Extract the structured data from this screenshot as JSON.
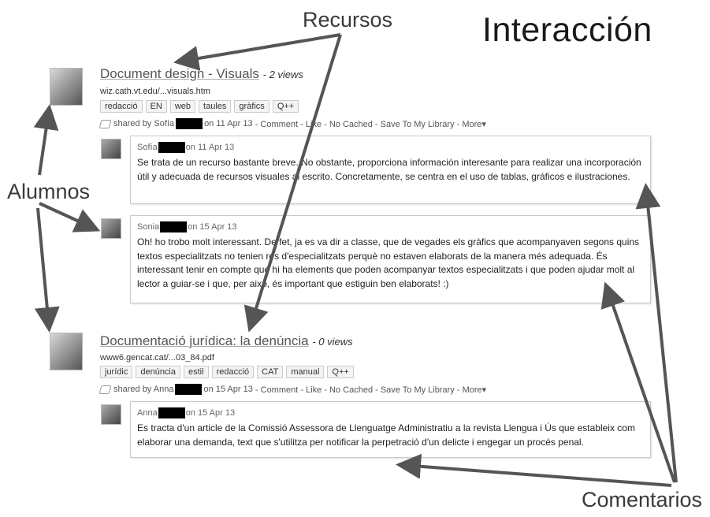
{
  "slide": {
    "title": "Interacción",
    "labels": {
      "recursos": "Recursos",
      "alumnos": "Alumnos",
      "comentarios": "Comentarios"
    }
  },
  "resources": [
    {
      "title": "Document design - Visuals",
      "views": "- 2 views",
      "url": "wiz.cath.vt.edu/...visuals.htm",
      "tags": [
        "redacció",
        "EN",
        "web",
        "taules",
        "gràfics",
        "Q++"
      ],
      "shared_prefix": "shared by Sofía",
      "shared_date": "on 11 Apr 13",
      "actions": "- Comment - Like - No Cached - Save To My Library - More▾",
      "comments": [
        {
          "author": "Sofía",
          "date": "on 11 Apr 13",
          "text": "Se trata de un recurso bastante breve. No obstante, proporciona información interesante para realizar una incorporación útil y adecuada de recursos visuales al escrito. Concretamente, se centra en el uso de tablas, gráficos e ilustraciones."
        },
        {
          "author": "Sonia",
          "date": "on 15 Apr 13",
          "text": "Oh! ho trobo molt interessant. De fet, ja es va dir a classe, que de vegades els gràfics que acompanyaven segons quins textos especialitzats no tenien res d'especialitzats perquè no estaven elaborats de la manera més adequada. És interessant tenir en compte que hi ha elements que poden acompanyar textos especialitzats i que poden ajudar molt al lector a guiar-se i que, per això, és important que estiguin ben elaborats! :)"
        }
      ]
    },
    {
      "title": "Documentació jurídica: la denúncia",
      "views": "- 0 views",
      "url": "www6.gencat.cat/...03_84.pdf",
      "tags": [
        "jurídic",
        "denúncia",
        "estil",
        "redacció",
        "CAT",
        "manual",
        "Q++"
      ],
      "shared_prefix": "shared by Anna",
      "shared_date": "on 15 Apr 13",
      "actions": "- Comment - Like - No Cached - Save To My Library - More▾",
      "comments": [
        {
          "author": "Anna",
          "date": "on 15 Apr 13",
          "text": "Es tracta d'un article de la Comissió Assessora de Llenguatge Administratiu a la revista Llengua i Ús que estableix com elaborar una demanda, text que s'utilitza per notificar la perpetració d'un delicte i engegar un procés penal."
        }
      ]
    }
  ]
}
